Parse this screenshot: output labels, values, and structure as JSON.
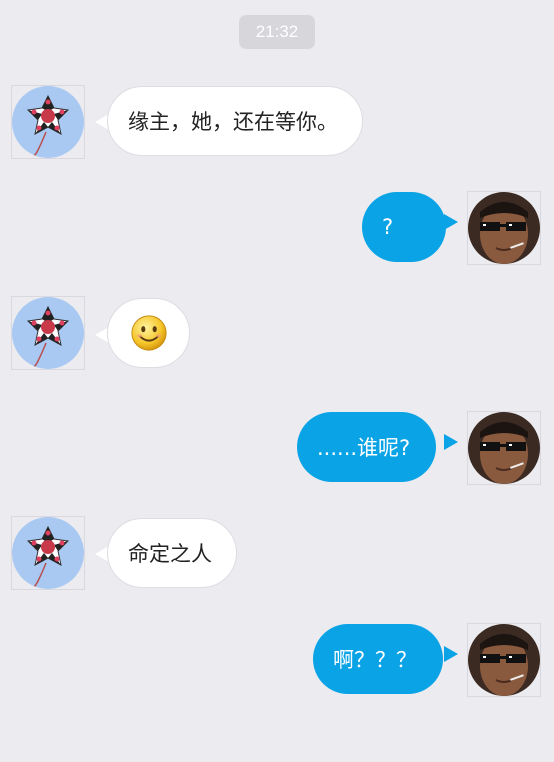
{
  "status": {
    "time": "21:32"
  },
  "messages": [
    {
      "side": "left",
      "text": "缘主，她，还在等你。"
    },
    {
      "side": "right",
      "text": "?"
    },
    {
      "side": "left",
      "emoji": "smile-emoji"
    },
    {
      "side": "right",
      "text": "......谁呢?"
    },
    {
      "side": "left",
      "text": "命定之人"
    },
    {
      "side": "right",
      "text": "啊？？？"
    }
  ],
  "colors": {
    "background": "#ebebf0",
    "bubble_left": "#ffffff",
    "bubble_right": "#0aa3e6",
    "time_badge": "#d6d6db"
  }
}
